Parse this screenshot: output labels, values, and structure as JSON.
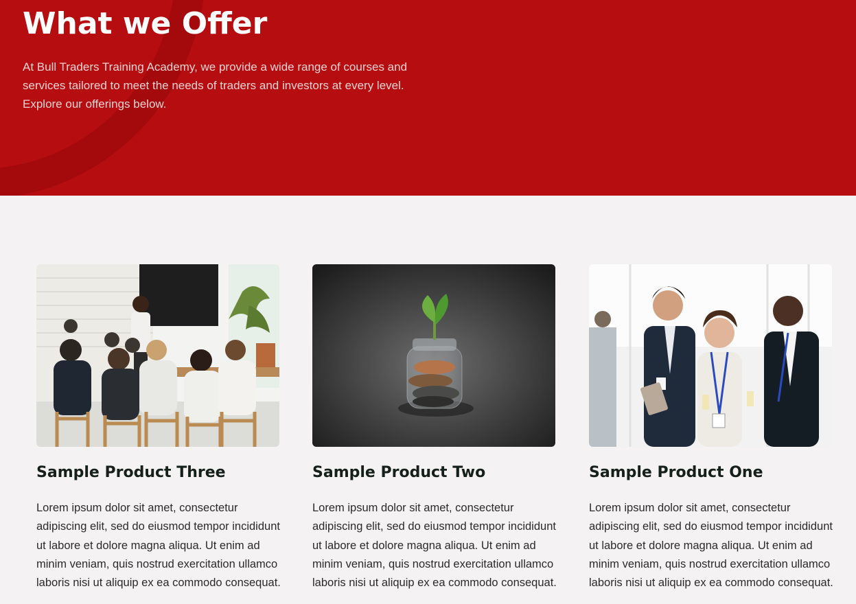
{
  "hero": {
    "title": "What we Offer",
    "description": "At Bull Traders Training Academy, we provide a wide range of courses and services tailored to meet the needs of traders and investors at every level. Explore our offerings below."
  },
  "products": [
    {
      "title": "Sample Product Three",
      "image": "classroom-training-photo",
      "description": "Lorem ipsum dolor sit amet, consectetur adipiscing elit, sed do eiusmod tempor incididunt ut labore et dolore magna aliqua. Ut enim ad minim veniam, quis nostrud exercitation ullamco laboris nisi ut aliquip ex ea commodo consequat."
    },
    {
      "title": "Sample Product Two",
      "image": "coin-jar-sprout-photo",
      "description": "Lorem ipsum dolor sit amet, consectetur adipiscing elit, sed do eiusmod tempor incididunt ut labore et dolore magna aliqua. Ut enim ad minim veniam, quis nostrud exercitation ullamco laboris nisi ut aliquip ex ea commodo consequat."
    },
    {
      "title": "Sample Product One",
      "image": "business-networking-photo",
      "description": "Lorem ipsum dolor sit amet, consectetur adipiscing elit, sed do eiusmod tempor incididunt ut labore et dolore magna aliqua. Ut enim ad minim veniam, quis nostrud exercitation ullamco laboris nisi ut aliquip ex ea commodo consequat."
    }
  ],
  "colors": {
    "hero_background": "#b60d10",
    "page_background": "#f5f2f3",
    "heading_text": "#16201a"
  }
}
